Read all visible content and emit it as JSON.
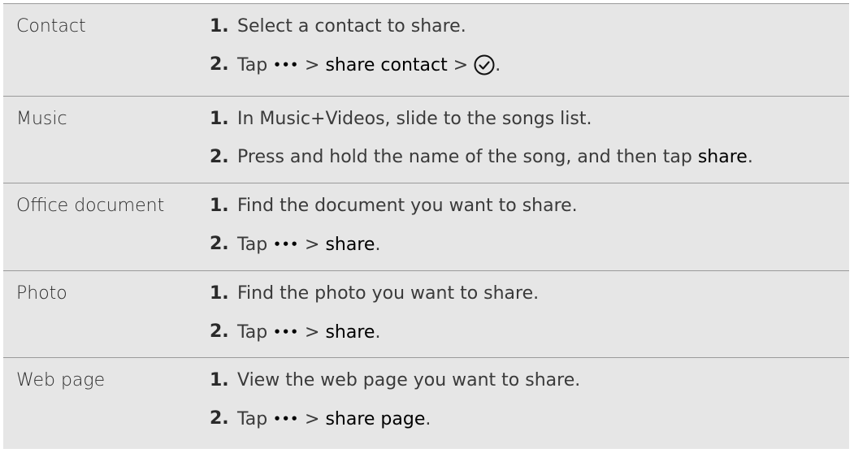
{
  "rows": [
    {
      "item": "Contact",
      "step1": {
        "num": "1.",
        "text": "Select a contact to share."
      },
      "step2": {
        "num": "2.",
        "pre": "Tap",
        "dots": "•••",
        "sep1": ">",
        "action": "share contact",
        "sep2": ">",
        "post": "."
      }
    },
    {
      "item": "Music",
      "step1": {
        "num": "1.",
        "text": "In Music+Videos, slide to the songs list."
      },
      "step2": {
        "num": "2.",
        "pre": "Press and hold the name of the song, and then tap",
        "action": "share",
        "post": "."
      }
    },
    {
      "item": "Office document",
      "step1": {
        "num": "1.",
        "text": "Find the document you want to share."
      },
      "step2": {
        "num": "2.",
        "pre": "Tap",
        "dots": "•••",
        "sep1": ">",
        "action": "share",
        "post": "."
      }
    },
    {
      "item": "Photo",
      "step1": {
        "num": "1.",
        "text": "Find the photo you want to share."
      },
      "step2": {
        "num": "2.",
        "pre": "Tap",
        "dots": "•••",
        "sep1": ">",
        "action": "share",
        "post": "."
      }
    },
    {
      "item": "Web page",
      "step1": {
        "num": "1.",
        "text": "View the web page you want to share."
      },
      "step2": {
        "num": "2.",
        "pre": "Tap",
        "dots": "•••",
        "sep1": ">",
        "action": "share page",
        "post": "."
      }
    }
  ],
  "icons": {
    "more": "more-dots-icon",
    "confirm": "check-circle-icon"
  },
  "colors": {
    "row_background": "#e6e6e6",
    "divider": "#9a9a9a",
    "text": "#3a3a3a"
  }
}
